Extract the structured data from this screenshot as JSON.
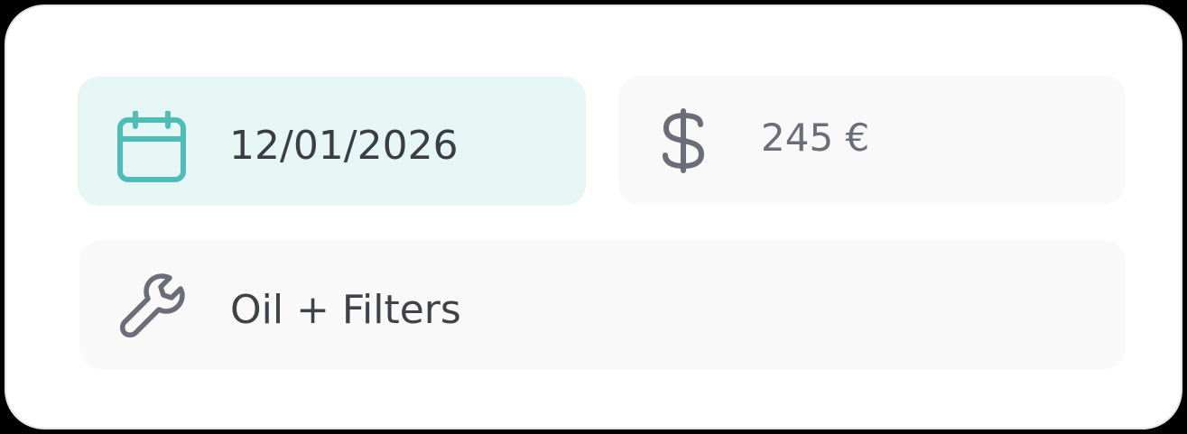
{
  "colors": {
    "accent": "#4dbdb5",
    "date_field_bg": "#e5f6f4",
    "field_bg": "#f9f9f9",
    "icon_gray": "#6b6e78"
  },
  "date_field": {
    "icon": "calendar-icon",
    "value": "12/01/2026"
  },
  "cost_field": {
    "icon": "dollar-icon",
    "value": "245 €"
  },
  "service_field": {
    "icon": "wrench-icon",
    "value": "Oil + Filters"
  }
}
